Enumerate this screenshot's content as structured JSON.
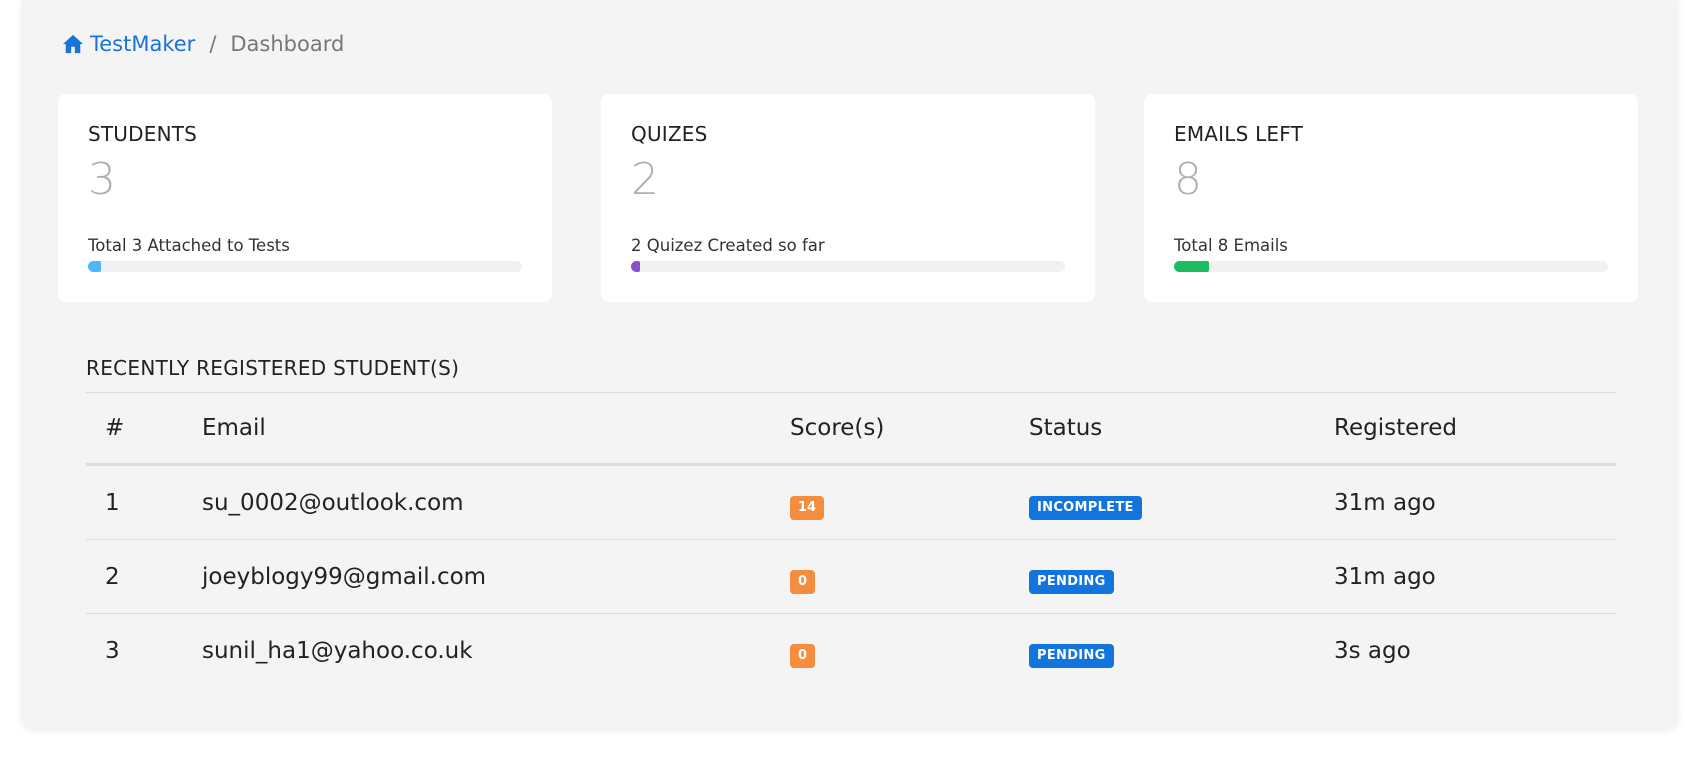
{
  "breadcrumb": {
    "home_label": "TestMaker",
    "current": "Dashboard",
    "separator": "/"
  },
  "cards": [
    {
      "title": "STUDENTS",
      "value": "3",
      "subtitle": "Total 3 Attached to Tests",
      "progress_percent": 3,
      "color": "#4db6f5"
    },
    {
      "title": "QUIZES",
      "value": "2",
      "subtitle": "2 Quizez Created so far",
      "progress_percent": 2,
      "color": "#8a52c9"
    },
    {
      "title": "EMAILS LEFT",
      "value": "8",
      "subtitle": "Total 8 Emails",
      "progress_percent": 8,
      "color": "#1cbd5e"
    }
  ],
  "recent": {
    "title": "RECENTLY REGISTERED STUDENT(S)",
    "columns": [
      "#",
      "Email",
      "Score(s)",
      "Status",
      "Registered"
    ],
    "rows": [
      {
        "num": "1",
        "email": "su_0002@outlook.com",
        "score": "14",
        "status": "INCOMPLETE",
        "registered": "31m ago"
      },
      {
        "num": "2",
        "email": "joeyblogy99@gmail.com",
        "score": "0",
        "status": "PENDING",
        "registered": "31m ago"
      },
      {
        "num": "3",
        "email": "sunil_ha1@yahoo.co.uk",
        "score": "0",
        "status": "PENDING",
        "registered": "3s ago"
      }
    ]
  },
  "colors": {
    "accent": "#1a73d9",
    "score_badge": "#f48d3e",
    "status_badge": "#1274dd"
  },
  "icons": {
    "home": "home-icon"
  }
}
